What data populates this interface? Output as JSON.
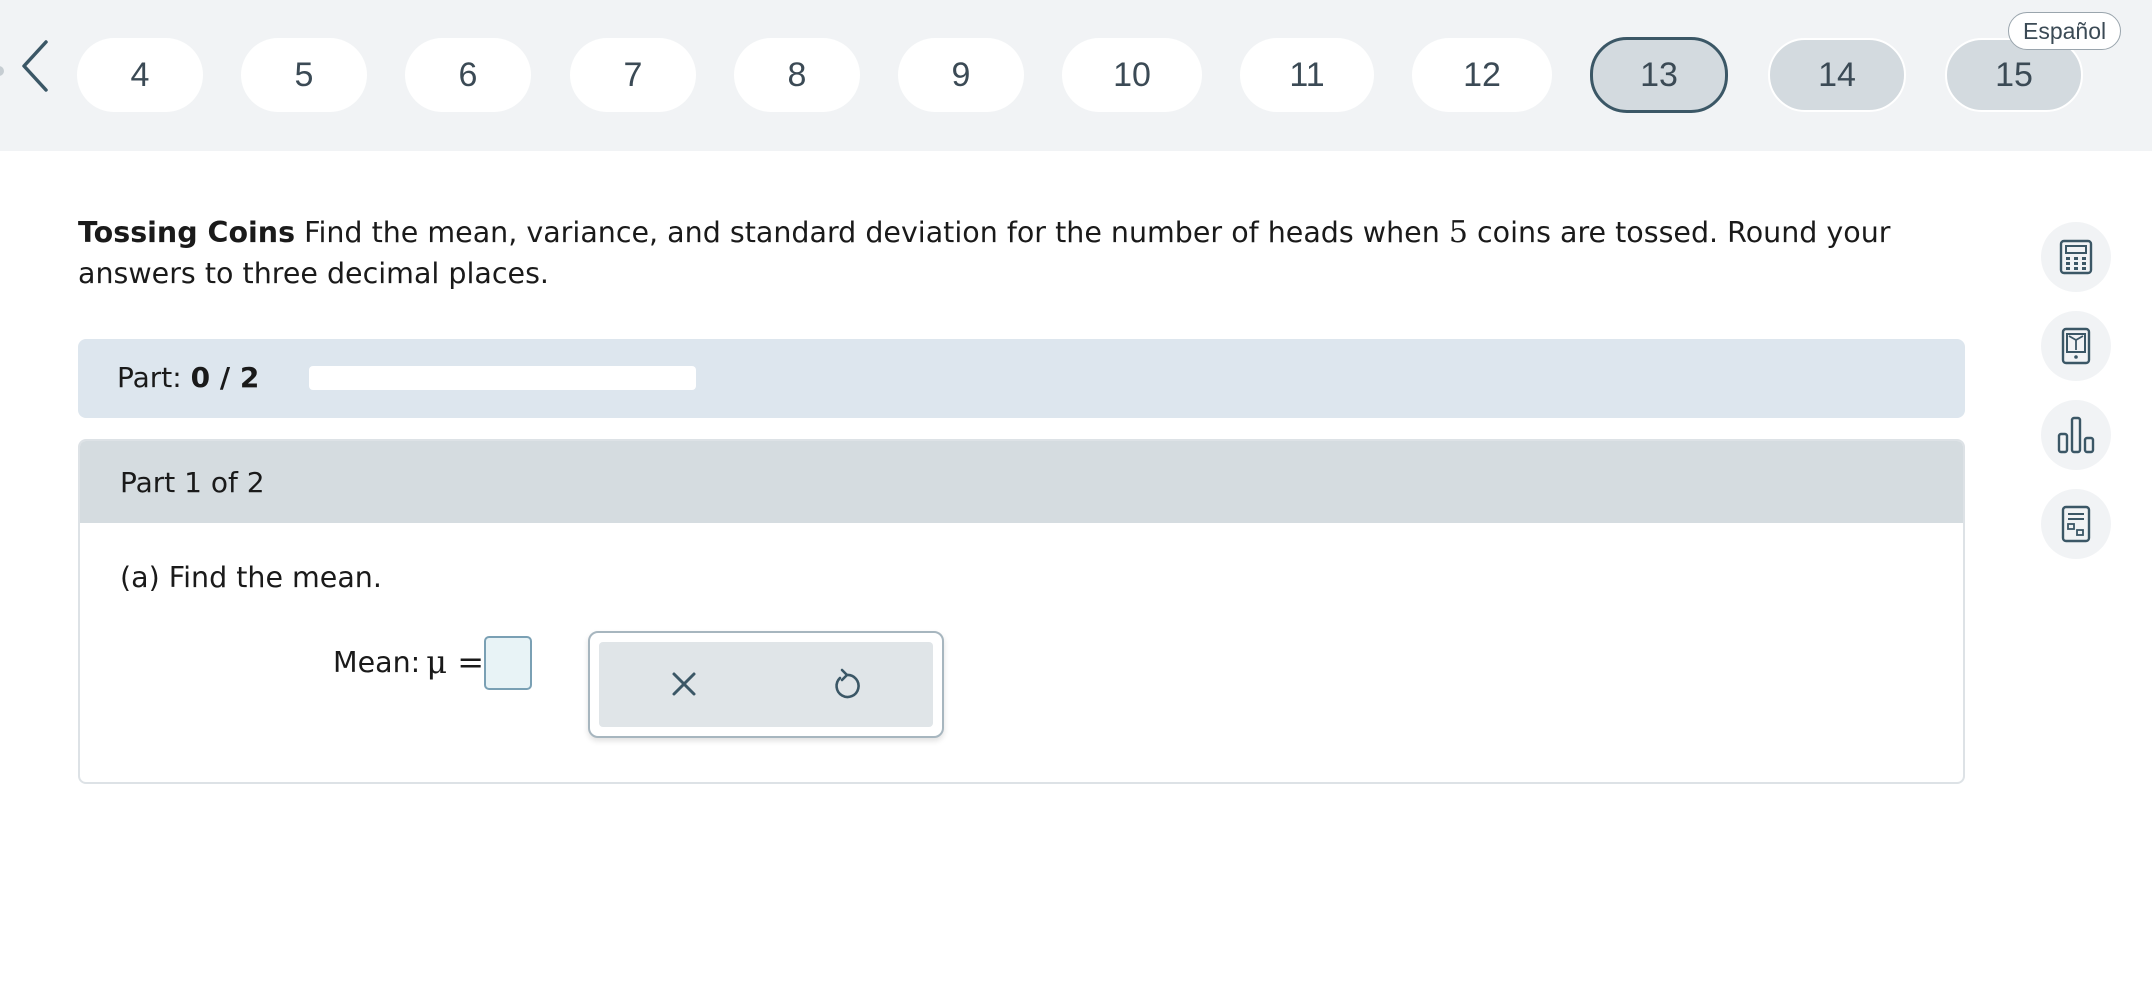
{
  "nav": {
    "language_label": "Español",
    "questions": [
      {
        "label": "4",
        "state": "plain"
      },
      {
        "label": "5",
        "state": "plain"
      },
      {
        "label": "6",
        "state": "plain"
      },
      {
        "label": "7",
        "state": "plain"
      },
      {
        "label": "8",
        "state": "plain"
      },
      {
        "label": "9",
        "state": "plain"
      },
      {
        "label": "10",
        "state": "plain"
      },
      {
        "label": "11",
        "state": "plain"
      },
      {
        "label": "12",
        "state": "plain"
      },
      {
        "label": "13",
        "state": "active"
      },
      {
        "label": "14",
        "state": "grey"
      },
      {
        "label": "15",
        "state": "grey"
      }
    ]
  },
  "question": {
    "title": "Tossing Coins",
    "text_before": " Find the mean, variance, and standard deviation for the number of heads when ",
    "number": "5",
    "text_after": " coins are tossed. Round your answers to three decimal places."
  },
  "progress": {
    "label": "Part:",
    "value": "0 / 2",
    "fraction": 0
  },
  "part": {
    "header": "Part 1 of 2",
    "subquestion": "(a) Find the mean.",
    "answer_label": "Mean:",
    "answer_symbol": "μ =",
    "answer_value": ""
  },
  "icons": {
    "back": "chevron-left-icon",
    "clear": "close-icon",
    "undo": "undo-icon",
    "tools": [
      "calculator-icon",
      "ebook-icon",
      "bar-chart-icon",
      "data-sheet-icon"
    ]
  },
  "colors": {
    "nav_bg": "#f1f3f5",
    "active_border": "#3b5766",
    "progress_bg": "#dde6ee",
    "part_header_bg": "#d5dce0",
    "input_bg": "#e8f3f6",
    "icon_color": "#3b5766"
  }
}
